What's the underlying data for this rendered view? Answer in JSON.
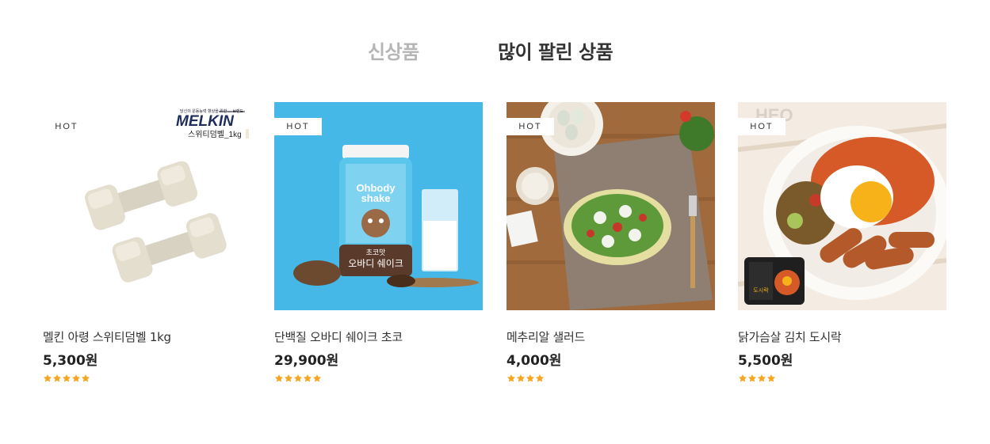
{
  "tabs": {
    "new_label": "신상품",
    "best_label": "많이 팔린 상품"
  },
  "badge_hot": "HOT",
  "products": [
    {
      "name": "멜킨 아령 스위티덤벨 1kg",
      "price": "5,300원",
      "rating": 5,
      "brand_logo": "MELKIN",
      "brand_tagline": "당신의 운동능력 향상을 위한 ... 브랜드",
      "brand_caption": "스위티덤벨_1kg"
    },
    {
      "name": "단백질 오바디 쉐이크 초코",
      "price": "29,900원",
      "rating": 5,
      "package_label": "Ohbody shake",
      "package_flavor": "초코맛",
      "package_name": "오바디 쉐이크"
    },
    {
      "name": "메추리알 샐러드",
      "price": "4,000원",
      "rating": 4
    },
    {
      "name": "닭가슴살 김치 도시락",
      "price": "5,500원",
      "rating": 4,
      "package_label": "도시락"
    }
  ],
  "colors": {
    "star": "#f5a623",
    "tab_active": "#333333",
    "tab_inactive": "#b5b5b5",
    "shake_bg": "#45b8e8"
  }
}
